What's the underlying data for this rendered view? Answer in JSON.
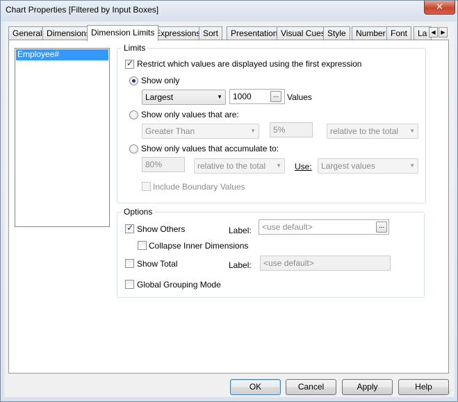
{
  "window": {
    "title": "Chart Properties [Filtered by Input Boxes]",
    "close_glyph": "✕"
  },
  "tabs": [
    {
      "label": "General"
    },
    {
      "label": "Dimensions"
    },
    {
      "label": "Dimension Limits",
      "active": true
    },
    {
      "label": "Expressions"
    },
    {
      "label": "Sort"
    },
    {
      "label": "Presentation"
    },
    {
      "label": "Visual Cues"
    },
    {
      "label": "Style"
    },
    {
      "label": "Number"
    },
    {
      "label": "Font"
    },
    {
      "label": "La"
    }
  ],
  "tab_scroll": {
    "left": "◀",
    "right": "▶"
  },
  "dimension_list": {
    "items": [
      "Employee#"
    ]
  },
  "limits": {
    "group_title": "Limits",
    "restrict_checkbox": {
      "label": "Restrict which values are displayed using the first expression",
      "checked": true
    },
    "show_only": {
      "radio_label": "Show only",
      "selected": true,
      "mode": "Largest",
      "count": "1000",
      "values_label": "Values"
    },
    "show_only_values_that_are": {
      "radio_label": "Show only values that are:",
      "operator": "Greater Than",
      "percent": "5%",
      "relative": "relative to the total"
    },
    "accumulate": {
      "radio_label": "Show only values that accumulate to:",
      "percent": "80%",
      "relative": "relative to the total",
      "use_label": "Use:",
      "use_value": "Largest values"
    },
    "include_boundary": {
      "label": "Include Boundary Values",
      "checked": false
    }
  },
  "options": {
    "group_title": "Options",
    "show_others": {
      "label": "Show Others",
      "checked": true,
      "label_field_label": "Label:",
      "placeholder": "<use default>"
    },
    "collapse_inner": {
      "label": "Collapse Inner Dimensions",
      "checked": false
    },
    "show_total": {
      "label": "Show Total",
      "checked": false,
      "label_field_label": "Label:",
      "placeholder": "<use default>"
    },
    "global_grouping": {
      "label": "Global Grouping Mode",
      "checked": false
    }
  },
  "buttons": {
    "ok": "OK",
    "cancel": "Cancel",
    "apply": "Apply",
    "help": "Help"
  },
  "icons": {
    "ellipsis": "...",
    "dropdown_arrow": "▼"
  }
}
